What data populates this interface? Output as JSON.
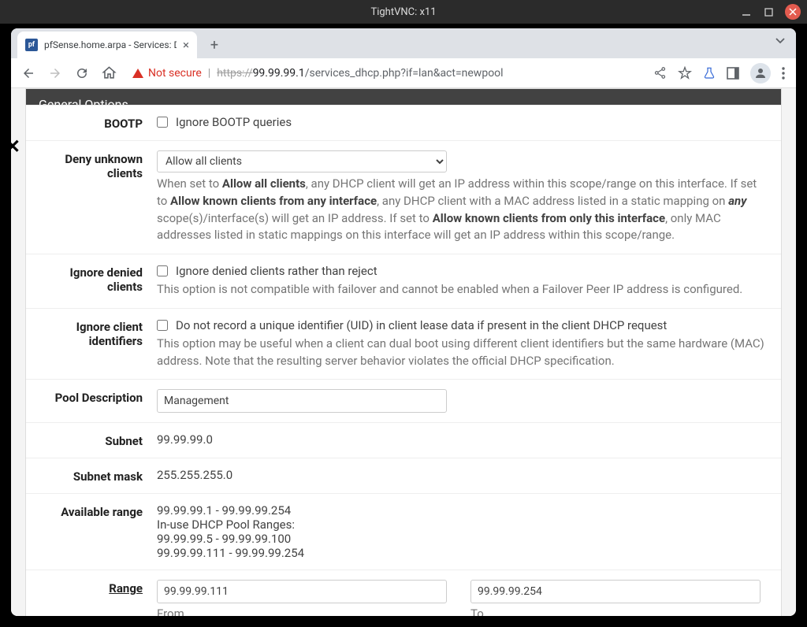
{
  "window": {
    "title": "TightVNC: x11"
  },
  "browser": {
    "tab_title": "pfSense.home.arpa - Services: DH",
    "not_secure": "Not secure",
    "url_scheme": "https://",
    "url_host": "99.99.99.1",
    "url_path": "/services_dhcp.php?if=lan&act=newpool"
  },
  "panel_title": "General Options",
  "fields": {
    "bootp": {
      "label": "BOOTP",
      "check_label": "Ignore BOOTP queries"
    },
    "deny": {
      "label": "Deny unknown clients",
      "selected": "Allow all clients",
      "help_pre": "When set to ",
      "h1": "Allow all clients",
      "help_2": ", any DHCP client will get an IP address within this scope/range on this interface. If set to ",
      "h2": "Allow known clients from any interface",
      "help_3": ", any DHCP client with a MAC address listed in a static mapping on ",
      "h3": "any",
      "help_4": " scope(s)/interface(s) will get an IP address. If set to ",
      "h4": "Allow known clients from only this interface",
      "help_5": ", only MAC addresses listed in static mappings on this interface will get an IP address within this scope/range."
    },
    "ignore_denied": {
      "label": "Ignore denied clients",
      "check_label": "Ignore denied clients rather than reject",
      "help": "This option is not compatible with failover and cannot be enabled when a Failover Peer IP address is configured."
    },
    "ignore_cid": {
      "label": "Ignore client identifiers",
      "check_label": "Do not record a unique identifier (UID) in client lease data if present in the client DHCP request",
      "help": "This option may be useful when a client can dual boot using different client identifiers but the same hardware (MAC) address. Note that the resulting server behavior violates the official DHCP specification."
    },
    "pooldesc": {
      "label": "Pool Description",
      "value": "Management"
    },
    "subnet": {
      "label": "Subnet",
      "value": "99.99.99.0"
    },
    "mask": {
      "label": "Subnet mask",
      "value": "255.255.255.0"
    },
    "avail": {
      "label": "Available range",
      "l1": "99.99.99.1 - 99.99.99.254",
      "l2": "In-use DHCP Pool Ranges:",
      "l3": "99.99.99.5 - 99.99.99.100",
      "l4": "99.99.99.111 - 99.99.99.254"
    },
    "range": {
      "label": "Range",
      "from": "99.99.99.111",
      "to": "99.99.99.254",
      "from_label": "From",
      "to_label": "To"
    }
  }
}
